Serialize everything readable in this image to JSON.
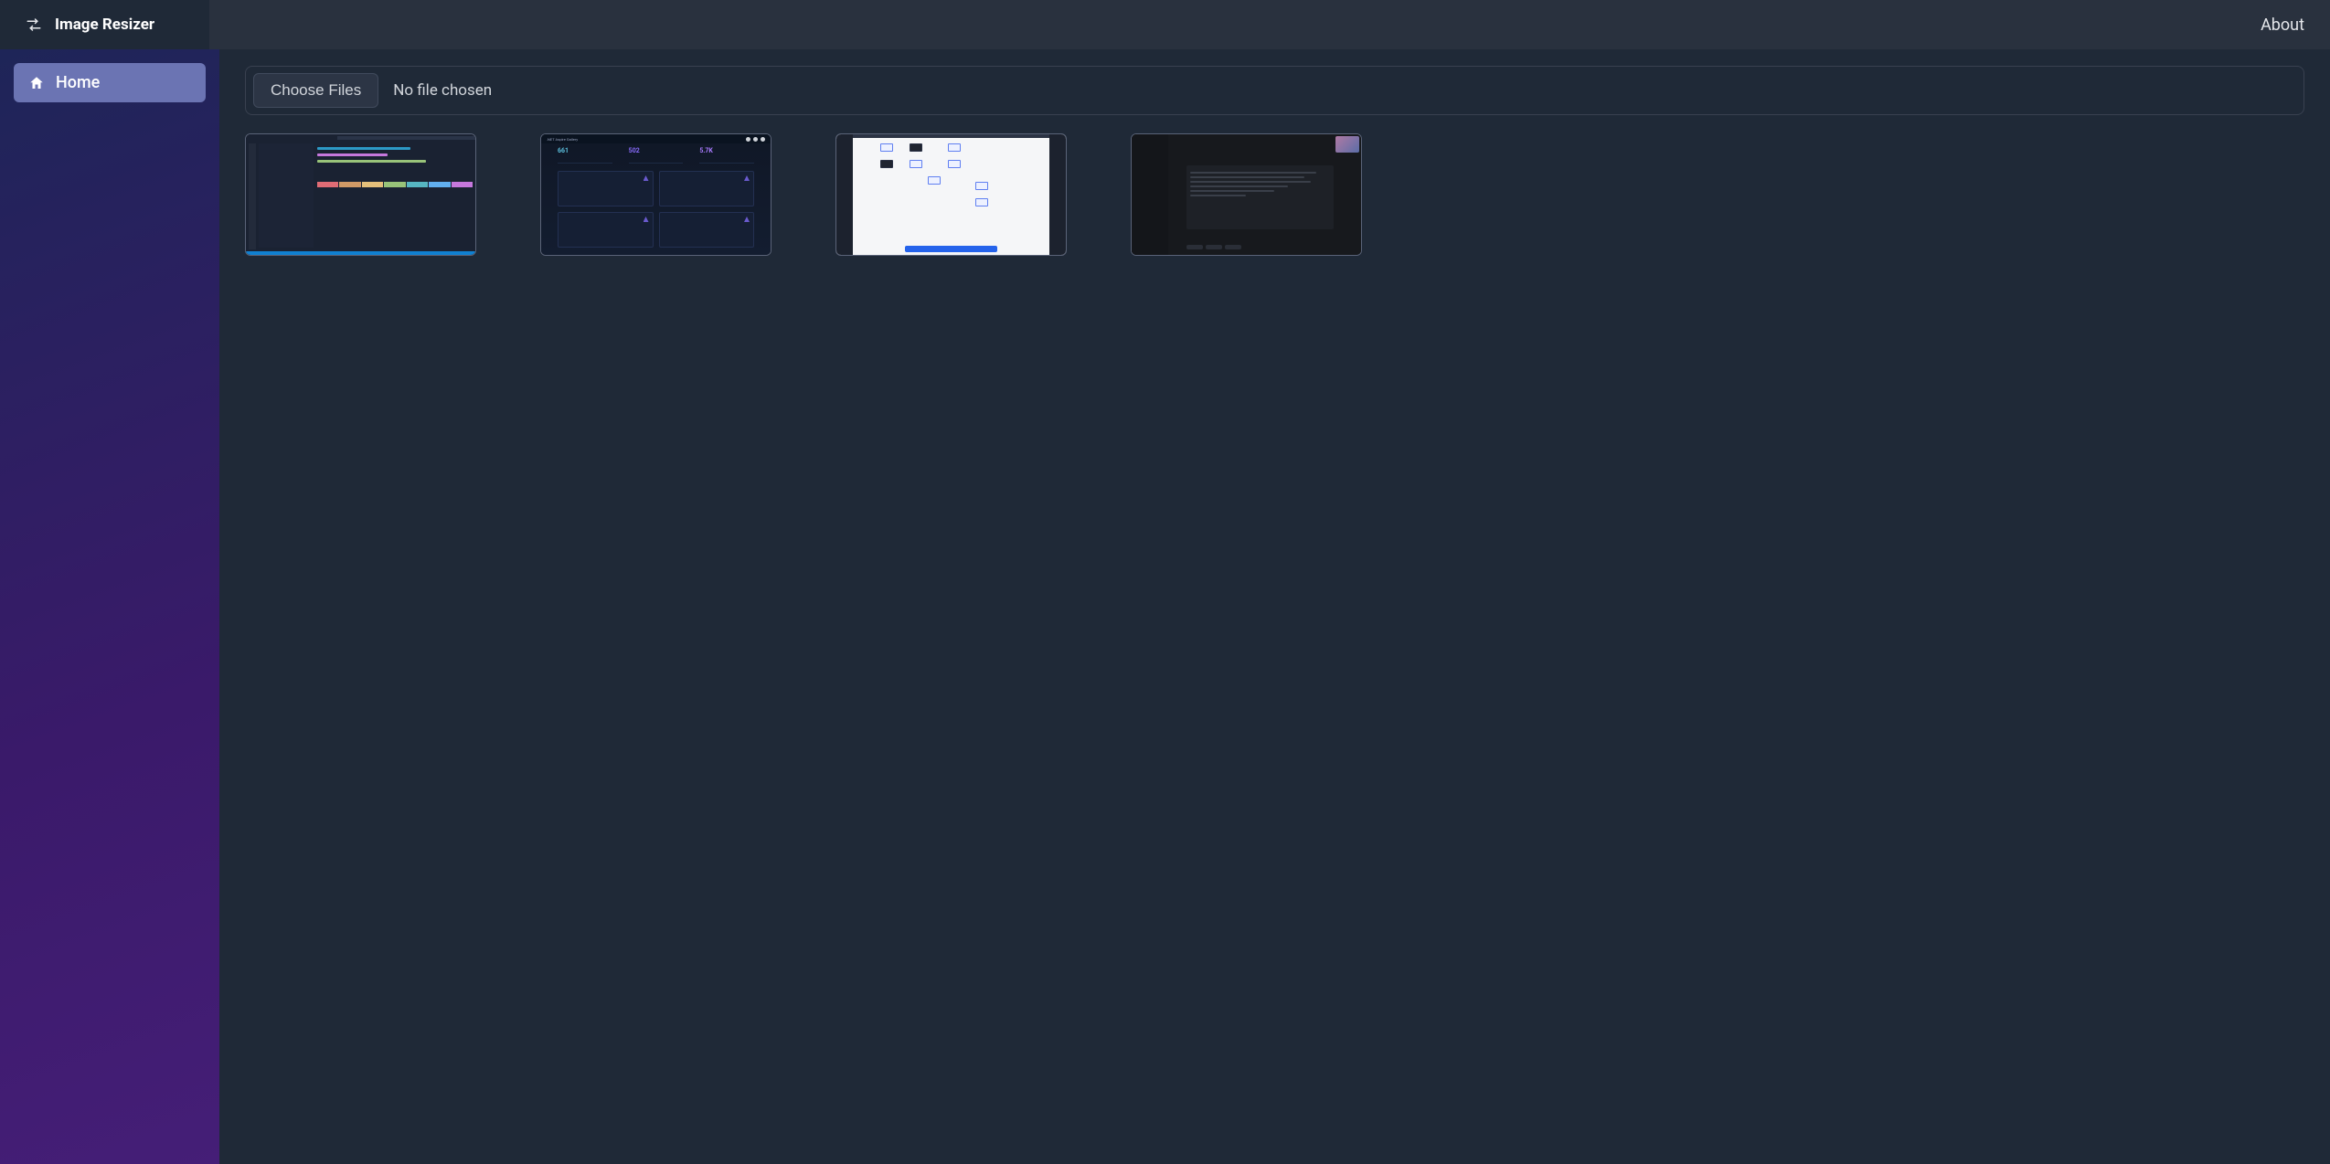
{
  "header": {
    "brand": "Image Resizer",
    "about": "About"
  },
  "sidebar": {
    "items": [
      {
        "label": "Home",
        "active": true
      }
    ]
  },
  "file_input": {
    "button_label": "Choose Files",
    "status_text": "No file chosen"
  },
  "thumbnails": [
    {
      "id": "thumb-1"
    },
    {
      "id": "thumb-2"
    },
    {
      "id": "thumb-3"
    },
    {
      "id": "thumb-4"
    }
  ]
}
